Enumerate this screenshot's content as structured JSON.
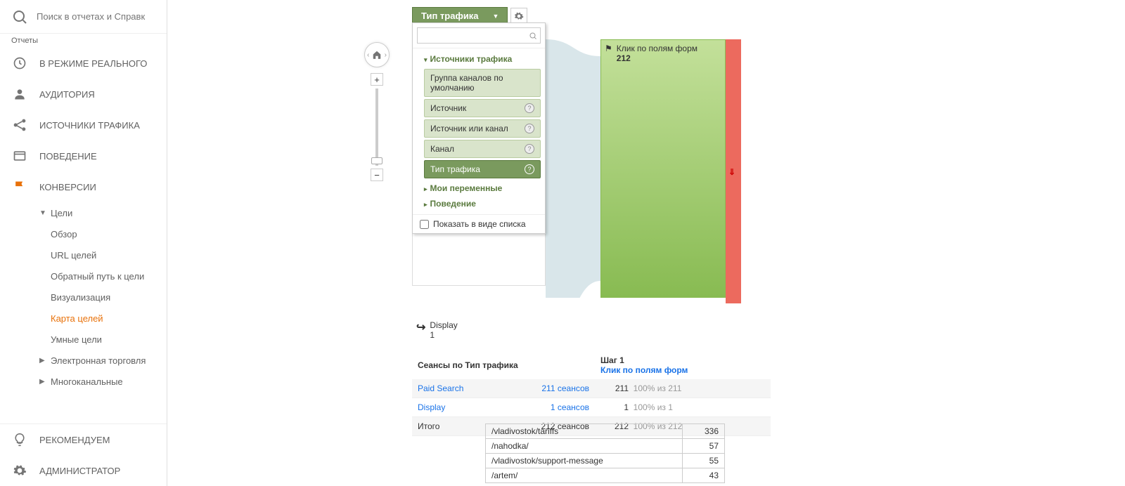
{
  "search": {
    "placeholder": "Поиск в отчетах и Справк"
  },
  "reports_label": "Отчеты",
  "nav": {
    "realtime": "В РЕЖИМЕ РЕАЛЬНОГО",
    "audience": "АУДИТОРИЯ",
    "acquisition": "ИСТОЧНИКИ ТРАФИКА",
    "behavior": "ПОВЕДЕНИЕ",
    "conversions": "КОНВЕРСИИ",
    "goals": "Цели",
    "overview": "Обзор",
    "url_goals": "URL целей",
    "reverse_path": "Обратный путь к цели",
    "funnel_viz": "Визуализация",
    "goal_flow": "Карта целей",
    "smart_goals": "Умные цели",
    "ecommerce": "Электронная торговля",
    "multichannel": "Многоканальные",
    "discover": "РЕКОМЕНДУЕМ",
    "admin": "АДМИНИСТРАТОР"
  },
  "dropdown": {
    "selected": "Тип трафика",
    "group_sources": "Источники трафика",
    "options": [
      {
        "label": "Группа каналов по умолчанию",
        "help": false
      },
      {
        "label": "Источник",
        "help": true
      },
      {
        "label": "Источник или канал",
        "help": true
      },
      {
        "label": "Канал",
        "help": true
      },
      {
        "label": "Тип трафика",
        "help": true,
        "selected": true
      }
    ],
    "group_myvars": "Мои переменные",
    "group_behavior": "Поведение",
    "show_as_list": "Показать в виде списка"
  },
  "funnel": {
    "step1_title": "Клик по полям форм",
    "step1_count": "212"
  },
  "display_entry": {
    "label": "Display",
    "count": "1"
  },
  "table": {
    "header_sessions": "Сеансы по Тип трафика",
    "header_step1": "Шаг 1",
    "header_step1_link": "Клик по полям форм",
    "rows": [
      {
        "name": "Paid Search",
        "sessions": "211 сеансов",
        "count": "211",
        "pct": "100% из 211",
        "link": true,
        "dim": true
      },
      {
        "name": "Display",
        "sessions": "1 сеансов",
        "count": "1",
        "pct": "100% из 1",
        "link": true,
        "dim": false
      },
      {
        "name": "Итого",
        "sessions": "212 сеансов",
        "count": "212",
        "pct": "100% из 212",
        "link": false,
        "dim": true
      }
    ]
  },
  "paths": [
    {
      "path": "/vladivostok/tariffs",
      "count": "336"
    },
    {
      "path": "/nahodka/",
      "count": "57"
    },
    {
      "path": "/vladivostok/support-message",
      "count": "55"
    },
    {
      "path": "/artem/",
      "count": "43"
    }
  ]
}
